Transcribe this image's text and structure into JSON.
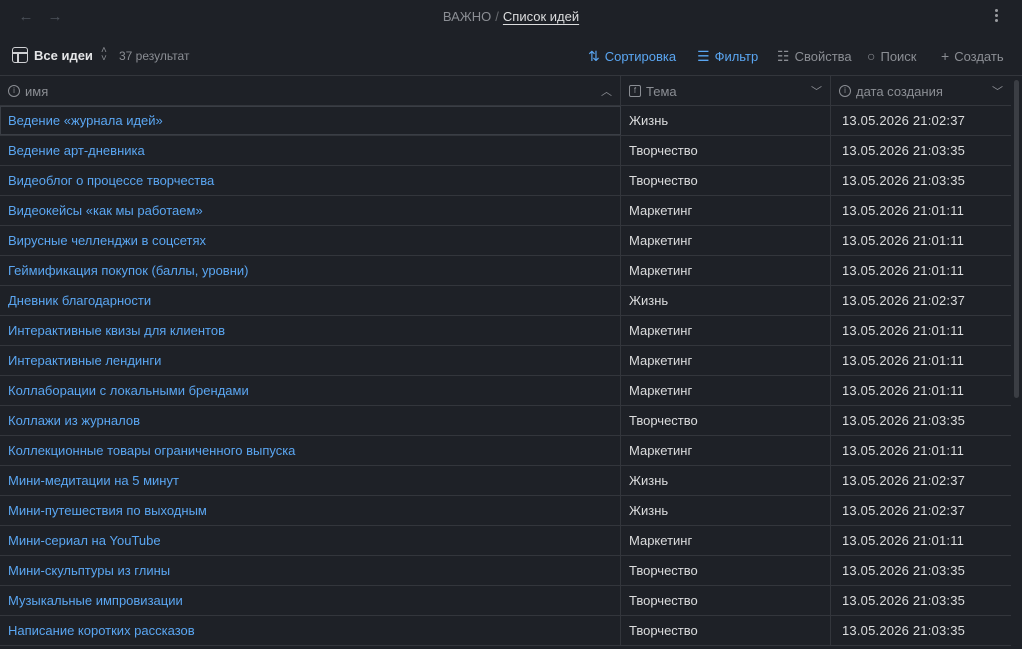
{
  "titlebar": {
    "breadcrumb_parent": "ВАЖНО",
    "breadcrumb_sep": "/",
    "breadcrumb_current": "Список идей",
    "back_icon": "←",
    "forward_icon": "→"
  },
  "toolbar": {
    "view_label": "Все идеи",
    "result_count": "37 результат",
    "sort_label": "Сортировка",
    "filter_label": "Фильтр",
    "props_label": "Свойства",
    "search_label": "Поиск",
    "create_label": "Создать"
  },
  "columns": {
    "name": "имя",
    "topic": "Тема",
    "date": "дата создания"
  },
  "colors": {
    "accent": "#5aa6f2",
    "background": "#1e2127",
    "border": "#33363c"
  },
  "rows": [
    {
      "name": "Ведение «журнала идей»",
      "topic": "Жизнь",
      "date": "13.05.2026 21:02:37"
    },
    {
      "name": "Ведение арт-дневника",
      "topic": "Творчество",
      "date": "13.05.2026 21:03:35"
    },
    {
      "name": "Видеоблог о процессе творчества",
      "topic": "Творчество",
      "date": "13.05.2026 21:03:35"
    },
    {
      "name": "Видеокейсы «как мы работаем»",
      "topic": "Маркетинг",
      "date": "13.05.2026 21:01:11"
    },
    {
      "name": "Вирусные челленджи в соцсетях",
      "topic": "Маркетинг",
      "date": "13.05.2026 21:01:11"
    },
    {
      "name": "Геймификация покупок (баллы, уровни)",
      "topic": "Маркетинг",
      "date": "13.05.2026 21:01:11"
    },
    {
      "name": "Дневник благодарности",
      "topic": "Жизнь",
      "date": "13.05.2026 21:02:37"
    },
    {
      "name": "Интерактивные квизы для клиентов",
      "topic": "Маркетинг",
      "date": "13.05.2026 21:01:11"
    },
    {
      "name": "Интерактивные лендинги",
      "topic": "Маркетинг",
      "date": "13.05.2026 21:01:11"
    },
    {
      "name": "Коллаборации с локальными брендами",
      "topic": "Маркетинг",
      "date": "13.05.2026 21:01:11"
    },
    {
      "name": "Коллажи из журналов",
      "topic": "Творчество",
      "date": "13.05.2026 21:03:35"
    },
    {
      "name": "Коллекционные товары ограниченного выпуска",
      "topic": "Маркетинг",
      "date": "13.05.2026 21:01:11"
    },
    {
      "name": "Мини-медитации на 5 минут",
      "topic": "Жизнь",
      "date": "13.05.2026 21:02:37"
    },
    {
      "name": "Мини-путешествия по выходным",
      "topic": "Жизнь",
      "date": "13.05.2026 21:02:37"
    },
    {
      "name": "Мини-сериал на YouTube",
      "topic": "Маркетинг",
      "date": "13.05.2026 21:01:11"
    },
    {
      "name": "Мини-скульптуры из глины",
      "topic": "Творчество",
      "date": "13.05.2026 21:03:35"
    },
    {
      "name": "Музыкальные импровизации",
      "topic": "Творчество",
      "date": "13.05.2026 21:03:35"
    },
    {
      "name": "Написание коротких рассказов",
      "topic": "Творчество",
      "date": "13.05.2026 21:03:35"
    }
  ]
}
